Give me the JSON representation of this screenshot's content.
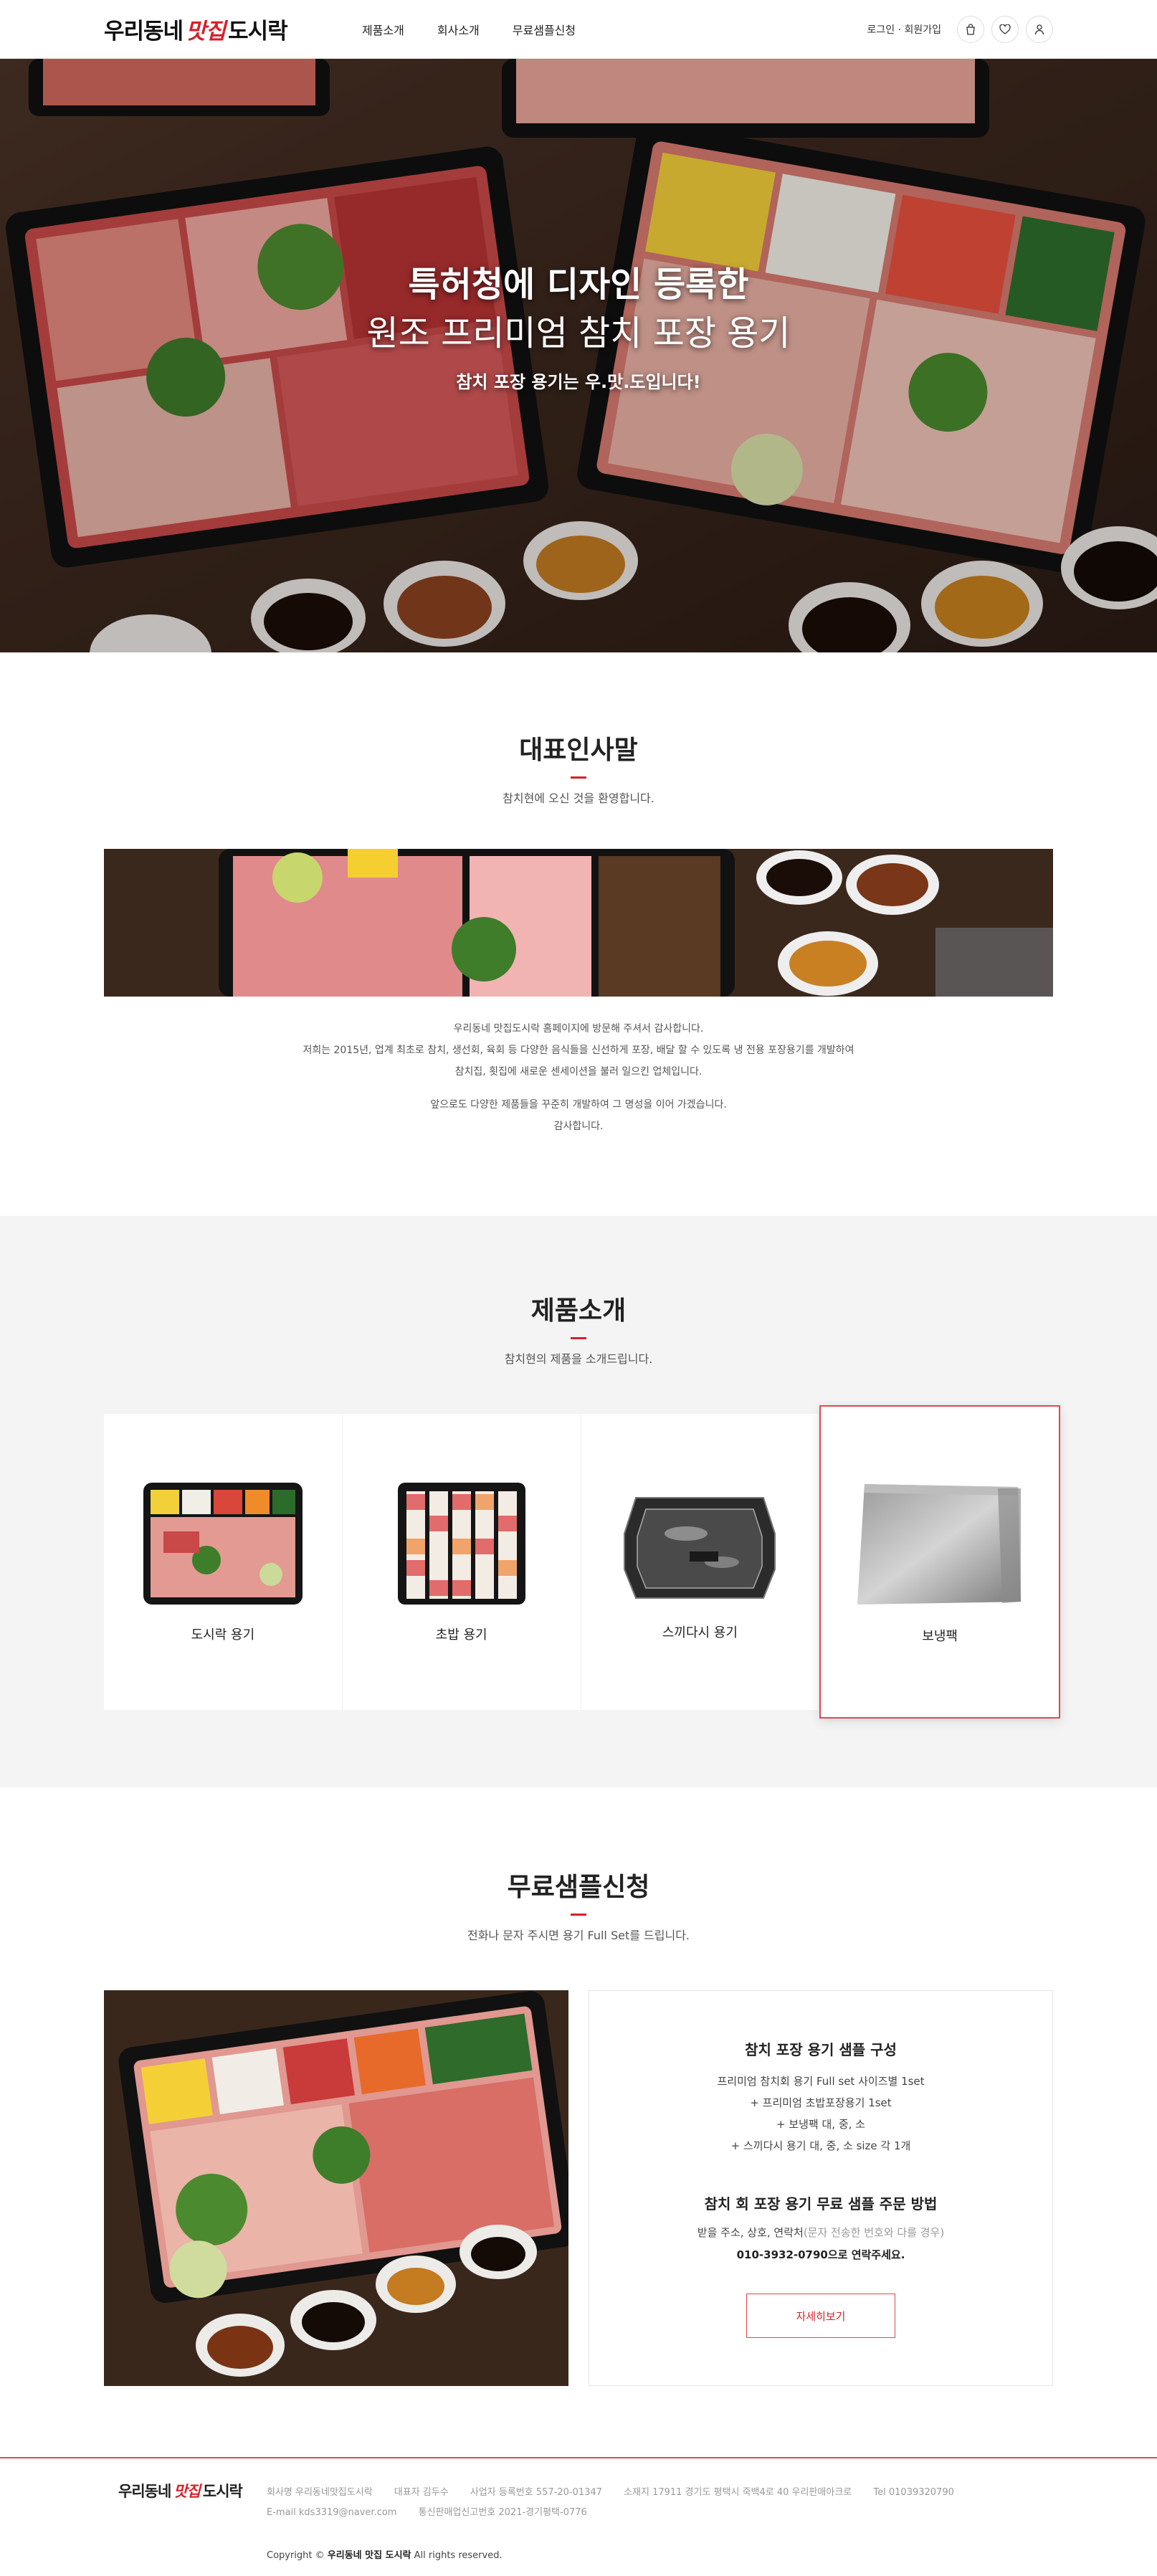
{
  "header": {
    "logo_black1": "우리동네",
    "logo_red": "맛집",
    "logo_black2": "도시락",
    "nav": [
      "제품소개",
      "회사소개",
      "무료샘플신청"
    ],
    "auth": "로그인 · 회원가입",
    "icons": [
      "bag-icon",
      "heart-icon",
      "user-icon"
    ]
  },
  "hero": {
    "line1": "특허청에 디자인 등록한",
    "line2": "원조 프리미엄 참치 포장 용기",
    "sub": "참치 포장 용기는 우.맛.도입니다!"
  },
  "greeting": {
    "title": "대표인사말",
    "subtitle": "참치현에 오신 것을 환영합니다.",
    "para1": [
      "우리동네 맛집도시락 홈페이지에 방문해 주셔서 감사합니다.",
      "저희는 2015년, 업계 최초로 참치, 생선회, 육회 등 다양한 음식들을 신선하게 포장, 배달 할 수 있도록 냉 전용 포장용기를 개발하여",
      "참치집, 횟집에 새로운 센세이션을 불러 일으킨 업체입니다."
    ],
    "para2": [
      "앞으로도 다양한 제품들을 꾸준히 개발하여 그 명성을 이어 가겠습니다.",
      "감사합니다."
    ]
  },
  "products": {
    "title": "제품소개",
    "subtitle": "참치현의 제품을 소개드립니다.",
    "items": [
      {
        "label": "도시락 용기"
      },
      {
        "label": "초밥 용기"
      },
      {
        "label": "스끼다시 용기"
      },
      {
        "label": "보냉팩"
      }
    ]
  },
  "sample": {
    "title": "무료샘플신청",
    "subtitle": "전화나 문자 주시면 용기 Full Set를 드립니다.",
    "box_title1": "참치 포장 용기 샘플 구성",
    "list": [
      "프리미엄 참치회 용기 Full set 사이즈별 1set",
      "+ 프리미엄 초밥포장용기 1set",
      "+ 보냉팩 대, 중, 소",
      "+ 스끼다시 용기 대, 중, 소 size 각 1개"
    ],
    "box_title2": "참치 회 포장 용기 무료 샘플 주문 방법",
    "addr": "받을 주소, 상호, 연락처",
    "addr_note": "(문자 전송한 번호와 다를 경우)",
    "phone": "010-3932-0790으로 연락주세요.",
    "button": "자세히보기"
  },
  "footer": {
    "logo_black1": "우리동네",
    "logo_red": "맛집",
    "logo_black2": "도시락",
    "info1": [
      "회사명 우리동네맛집도시락",
      "대표자 김두수",
      "사업자 등록번호 557-20-01347",
      "소재지 17911 경기도 평택시 죽백4로 40 우리판매아크로",
      "Tel 01039320790"
    ],
    "info2": [
      "E-mail kds3319@naver.com",
      "통신판매업신고번호 2021-경기평택-0776"
    ],
    "copy_pre": "Copyright ©",
    "copy_brand": "우리동네 맛집 도시락",
    "copy_post": "All rights reserved."
  },
  "colors": {
    "accent": "#d6202a",
    "gray_bg": "#f4f4f4"
  }
}
